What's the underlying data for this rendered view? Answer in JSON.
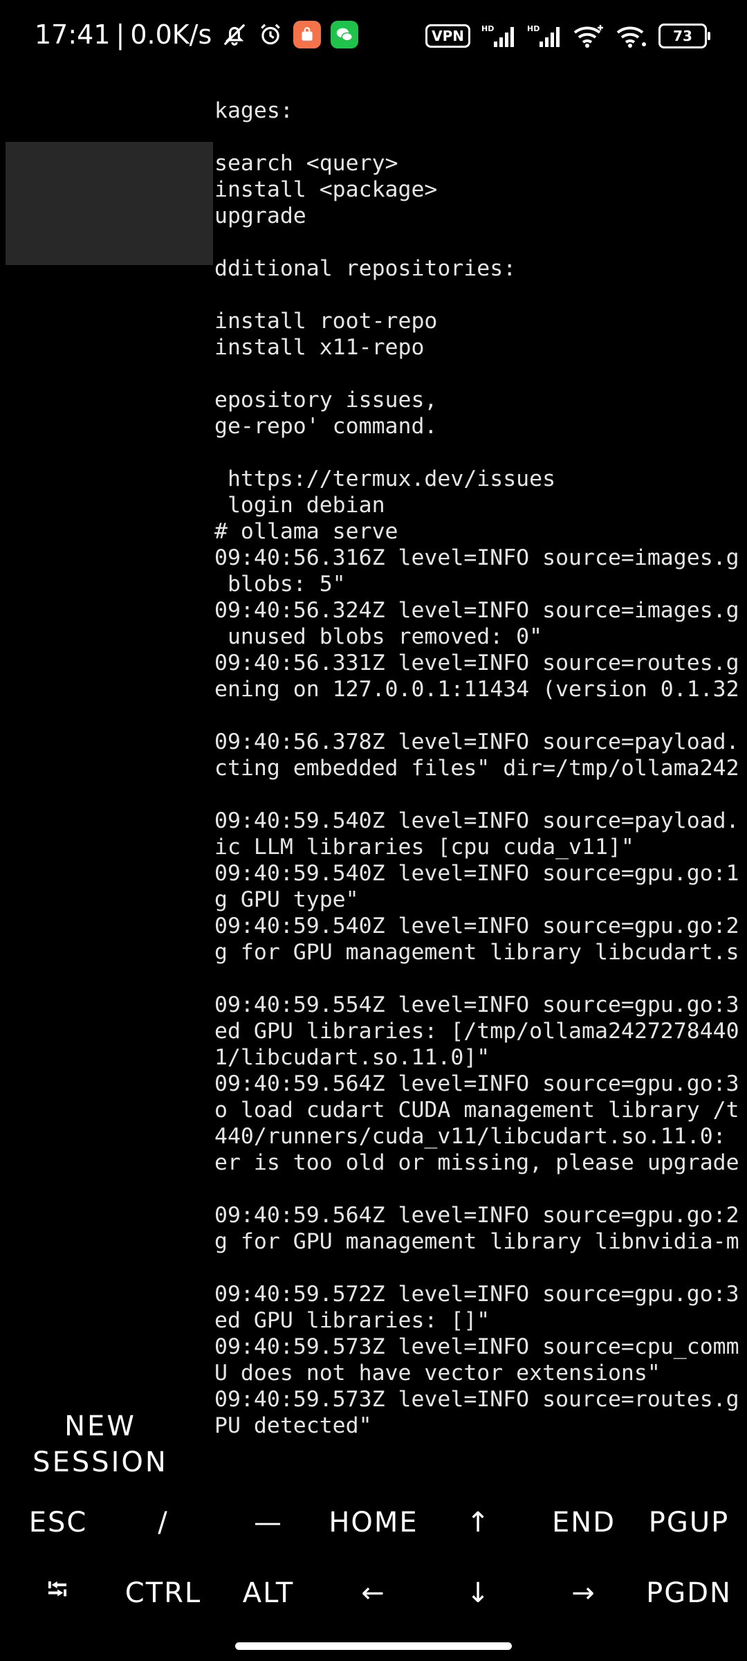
{
  "status_bar": {
    "time": "17:41",
    "separator": "|",
    "net_speed": "0.0K/s",
    "vpn": "VPN",
    "battery": "73",
    "icons": [
      "mute-bell-icon",
      "alarm-icon",
      "app-notification-icon",
      "wechat-icon",
      "vpn-icon",
      "signal-hd-icon",
      "signal-hd-icon",
      "wifi-plus-icon",
      "wifi-icon",
      "battery-icon"
    ]
  },
  "drawer": {
    "new_session_line1": "NEW",
    "new_session_line2": "SESSION"
  },
  "terminal": {
    "lines": [
      "kages:",
      "",
      "search <query>",
      "install <package>",
      "upgrade",
      "",
      "dditional repositories:",
      "",
      "install root-repo",
      "install x11-repo",
      "",
      "epository issues,",
      "ge-repo' command.",
      "",
      " https://termux.dev/issues",
      " login debian",
      "# ollama serve",
      "09:40:56.316Z level=INFO source=images.g",
      " blobs: 5\"",
      "09:40:56.324Z level=INFO source=images.g",
      " unused blobs removed: 0\"",
      "09:40:56.331Z level=INFO source=routes.g",
      "ening on 127.0.0.1:11434 (version 0.1.32",
      "",
      "09:40:56.378Z level=INFO source=payload.",
      "cting embedded files\" dir=/tmp/ollama242",
      "",
      "09:40:59.540Z level=INFO source=payload.",
      "ic LLM libraries [cpu cuda_v11]\"",
      "09:40:59.540Z level=INFO source=gpu.go:1",
      "g GPU type\"",
      "09:40:59.540Z level=INFO source=gpu.go:2",
      "g for GPU management library libcudart.s",
      "",
      "09:40:59.554Z level=INFO source=gpu.go:3",
      "ed GPU libraries: [/tmp/ollama2427278440",
      "1/libcudart.so.11.0]\"",
      "09:40:59.564Z level=INFO source=gpu.go:3",
      "o load cudart CUDA management library /t",
      "440/runners/cuda_v11/libcudart.so.11.0:",
      "er is too old or missing, please upgrade",
      "",
      "09:40:59.564Z level=INFO source=gpu.go:2",
      "g for GPU management library libnvidia-m",
      "",
      "09:40:59.572Z level=INFO source=gpu.go:3",
      "ed GPU libraries: []\"",
      "09:40:59.573Z level=INFO source=cpu_comm",
      "U does not have vector extensions\"",
      "09:40:59.573Z level=INFO source=routes.g",
      "PU detected\""
    ]
  },
  "extra_keys": {
    "row1": [
      "ESC",
      "/",
      "—",
      "HOME",
      "↑",
      "END",
      "PGUP"
    ],
    "row2": [
      "⭾",
      "CTRL",
      "ALT",
      "←",
      "↓",
      "→",
      "PGDN"
    ]
  }
}
